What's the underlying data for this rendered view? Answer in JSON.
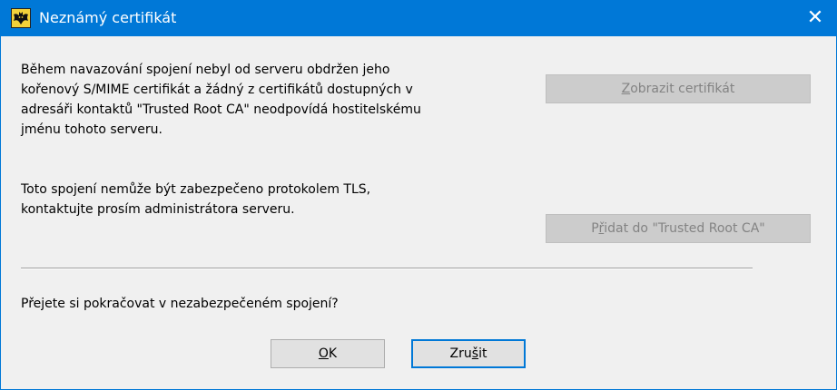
{
  "window": {
    "title": "Neznámý certifikát",
    "close_glyph": "✕",
    "icon": "bat-app-icon"
  },
  "message": {
    "paragraph1": "Během navazování spojení nebyl od serveru obdržen jeho\nkořenový S/MIME certifikát a žádný z certifikátů dostupných v\nadresáři kontaktů \"Trusted Root CA\" neodpovídá hostitelskému\njménu tohoto serveru.",
    "paragraph2": "Toto spojení nemůže být zabezpečeno protokolem TLS,\nkontaktujte prosím administrátora serveru.",
    "question": "Přejete si pokračovat v nezabezpečeném spojení?"
  },
  "buttons": {
    "view_cert": {
      "mnemonic": "Z",
      "rest": "obrazit certifikát"
    },
    "add_root": {
      "before": "P",
      "mnemonic": "ř",
      "rest": "idat do \"Trusted Root CA\""
    },
    "ok": {
      "mnemonic": "O",
      "rest": "K"
    },
    "cancel": {
      "before": "Zru",
      "mnemonic": "š",
      "rest": "it"
    }
  },
  "colors": {
    "titlebar": "#0078d7",
    "dialog_bg": "#f0f0f0",
    "disabled_text": "#838383"
  }
}
